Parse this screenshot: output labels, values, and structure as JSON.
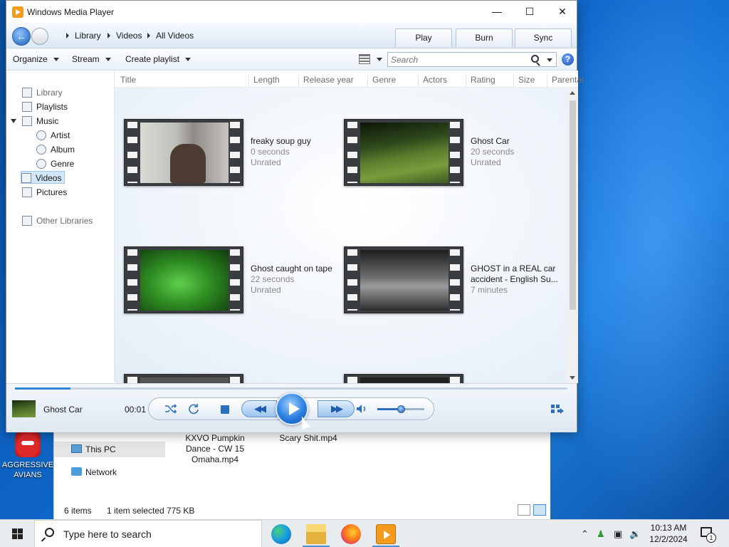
{
  "desktop": {
    "icon_label": "AGGRESSIVE AVIANS"
  },
  "explorer": {
    "nav": [
      "This PC",
      "Network"
    ],
    "files": [
      "KXVO Pumpkin Dance - CW 15 Omaha.mp4",
      "Scary Shit.mp4"
    ],
    "status": {
      "items": "6 items",
      "selected": "1 item selected",
      "size": "775 KB"
    }
  },
  "wmp": {
    "title": "Windows Media Player",
    "window_buttons": {
      "min": "—",
      "max": "☐",
      "close": "✕"
    },
    "breadcrumb": [
      "Library",
      "Videos",
      "All Videos"
    ],
    "tabs": {
      "play": "Play",
      "burn": "Burn",
      "sync": "Sync"
    },
    "toolbar": {
      "organize": "Organize",
      "stream": "Stream",
      "create_playlist": "Create playlist"
    },
    "search": {
      "placeholder": "Search"
    },
    "help": "?",
    "sidebar": {
      "library": "Library",
      "playlists": "Playlists",
      "music": "Music",
      "artist": "Artist",
      "album": "Album",
      "genre": "Genre",
      "videos": "Videos",
      "pictures": "Pictures",
      "other_libraries": "Other Libraries"
    },
    "columns": [
      "Title",
      "Length",
      "Release year",
      "Genre",
      "Actors",
      "Rating",
      "Size",
      "Parental"
    ],
    "videos": [
      {
        "title": "freaky soup guy",
        "length": "0 seconds",
        "rating": "Unrated"
      },
      {
        "title": "Ghost Car",
        "length": "20 seconds",
        "rating": "Unrated"
      },
      {
        "title": "Ghost caught on tape",
        "length": "22 seconds",
        "rating": "Unrated"
      },
      {
        "title": "GHOST in a REAL car accident - English Su...",
        "length": "7 minutes"
      }
    ],
    "player": {
      "now_playing": "Ghost Car",
      "time": "00:01",
      "seek_fraction": 0.1,
      "volume_fraction": 0.5
    }
  },
  "taskbar": {
    "search_placeholder": "Type here to search",
    "time": "10:13 AM",
    "date": "12/2/2024",
    "notifications": "1"
  }
}
